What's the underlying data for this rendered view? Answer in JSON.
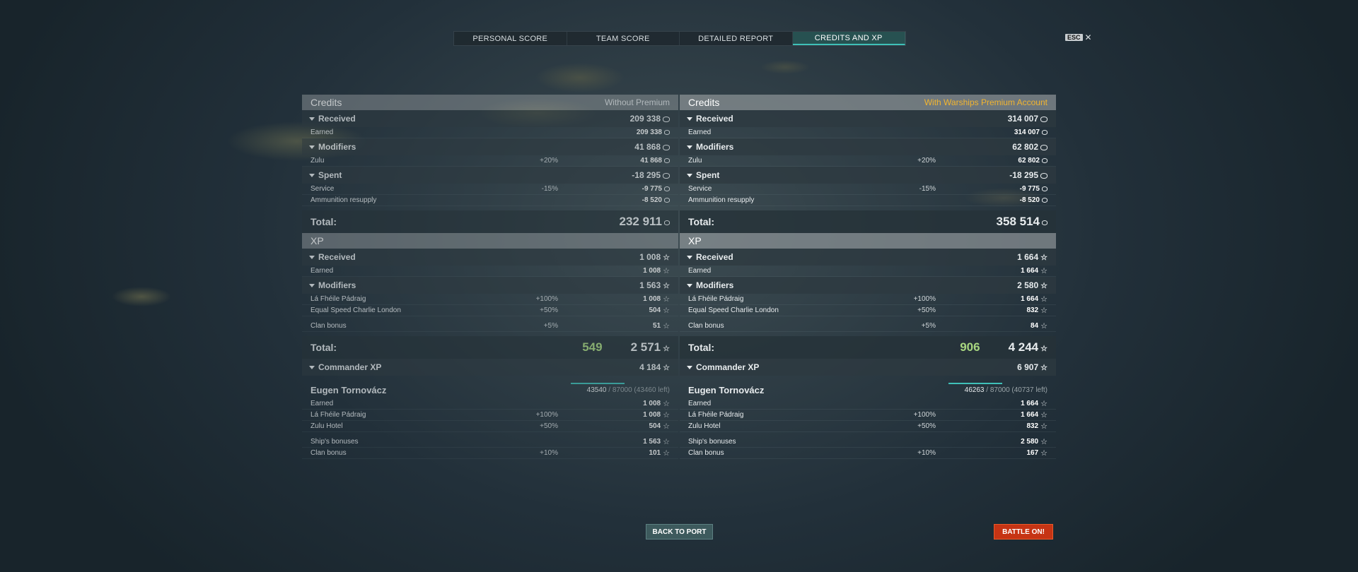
{
  "tabs": [
    "PERSONAL SCORE",
    "TEAM SCORE",
    "DETAILED REPORT",
    "CREDITS AND XP"
  ],
  "esc": {
    "key": "ESC",
    "close": "✕"
  },
  "credits_icon": "coin-icon",
  "xp_icon": "star-icon",
  "left": {
    "credits_title": "Credits",
    "header": "Without Premium",
    "received": {
      "label": "Received",
      "value": "209 338"
    },
    "earned": {
      "label": "Earned",
      "value": "209 338"
    },
    "modifiers": {
      "label": "Modifiers",
      "value": "41 868"
    },
    "zulu": {
      "label": "Zulu",
      "pct": "+20%",
      "value": "41 868"
    },
    "spent": {
      "label": "Spent",
      "value": "-18 295"
    },
    "service": {
      "label": "Service",
      "pct": "-15%",
      "value": "-9 775"
    },
    "ammo": {
      "label": "Ammunition resupply",
      "value": "-8 520"
    },
    "credits_total": {
      "label": "Total:",
      "value": "232 911"
    },
    "xp_title": "XP",
    "xp_received": {
      "label": "Received",
      "value": "1 008"
    },
    "xp_earned": {
      "label": "Earned",
      "value": "1 008"
    },
    "xp_modifiers": {
      "label": "Modifiers",
      "value": "1 563"
    },
    "la_fheile": {
      "label": "Lá Fhéile Pádraig",
      "pct": "+100%",
      "value": "1 008"
    },
    "esc_london": {
      "label": "Equal Speed Charlie London",
      "pct": "+50%",
      "value": "504"
    },
    "clan": {
      "label": "Clan bonus",
      "pct": "+5%",
      "value": "51"
    },
    "xp_total": {
      "label": "Total:",
      "premium": "549",
      "value": "2 571"
    },
    "commander_xp": {
      "label": "Commander XP",
      "value": "4 184"
    },
    "commander": {
      "name": "Eugen Tornovácz",
      "xp": "43540",
      "rest": "/ 87000 (43460 left)"
    },
    "c_earned": {
      "label": "Earned",
      "value": "1 008"
    },
    "c_la": {
      "label": "Lá Fhéile Pádraig",
      "pct": "+100%",
      "value": "1 008"
    },
    "c_zulu": {
      "label": "Zulu Hotel",
      "pct": "+50%",
      "value": "504"
    },
    "c_ship": {
      "label": "Ship's bonuses",
      "value": "1 563"
    },
    "c_clan": {
      "label": "Clan bonus",
      "pct": "+10%",
      "value": "101"
    }
  },
  "right": {
    "credits_title": "Credits",
    "header": "With Warships Premium Account",
    "received": {
      "label": "Received",
      "value": "314 007"
    },
    "earned": {
      "label": "Earned",
      "value": "314 007"
    },
    "modifiers": {
      "label": "Modifiers",
      "value": "62 802"
    },
    "zulu": {
      "label": "Zulu",
      "pct": "+20%",
      "value": "62 802"
    },
    "spent": {
      "label": "Spent",
      "value": "-18 295"
    },
    "service": {
      "label": "Service",
      "pct": "-15%",
      "value": "-9 775"
    },
    "ammo": {
      "label": "Ammunition resupply",
      "value": "-8 520"
    },
    "credits_total": {
      "label": "Total:",
      "value": "358 514"
    },
    "xp_title": "XP",
    "xp_received": {
      "label": "Received",
      "value": "1 664"
    },
    "xp_earned": {
      "label": "Earned",
      "value": "1 664"
    },
    "xp_modifiers": {
      "label": "Modifiers",
      "value": "2 580"
    },
    "la_fheile": {
      "label": "Lá Fhéile Pádraig",
      "pct": "+100%",
      "value": "1 664"
    },
    "esc_london": {
      "label": "Equal Speed Charlie London",
      "pct": "+50%",
      "value": "832"
    },
    "clan": {
      "label": "Clan bonus",
      "pct": "+5%",
      "value": "84"
    },
    "xp_total": {
      "label": "Total:",
      "premium": "906",
      "value": "4 244"
    },
    "commander_xp": {
      "label": "Commander XP",
      "value": "6 907"
    },
    "commander": {
      "name": "Eugen Tornovácz",
      "xp": "46263",
      "rest": "/ 87000 (40737 left)"
    },
    "c_earned": {
      "label": "Earned",
      "value": "1 664"
    },
    "c_la": {
      "label": "Lá Fhéile Pádraig",
      "pct": "+100%",
      "value": "1 664"
    },
    "c_zulu": {
      "label": "Zulu Hotel",
      "pct": "+50%",
      "value": "832"
    },
    "c_ship": {
      "label": "Ship's bonuses",
      "value": "2 580"
    },
    "c_clan": {
      "label": "Clan bonus",
      "pct": "+10%",
      "value": "167"
    }
  },
  "buttons": {
    "back": "BACK TO PORT",
    "battle": "BATTLE ON!"
  }
}
